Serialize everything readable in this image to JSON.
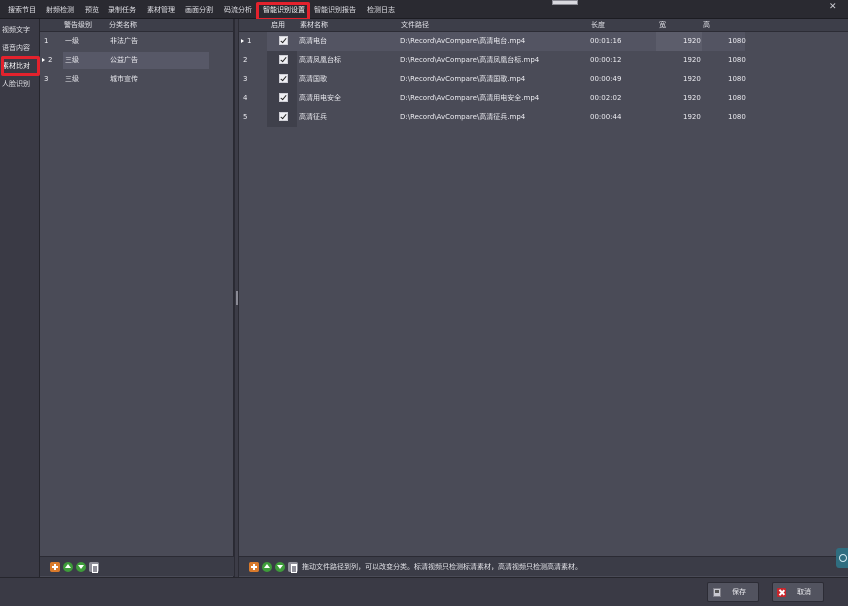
{
  "top_tabs": [
    {
      "label": "搜索节目"
    },
    {
      "label": "射频检测"
    },
    {
      "label": "预览"
    },
    {
      "label": "录制任务"
    },
    {
      "label": "素材管理"
    },
    {
      "label": "画面分割"
    },
    {
      "label": "码流分析"
    },
    {
      "label": "智能识别设置"
    },
    {
      "label": "智能识别报告"
    },
    {
      "label": "检测日志"
    }
  ],
  "left_nav": [
    {
      "label": "视频文字"
    },
    {
      "label": "语音内容"
    },
    {
      "label": "素材比对"
    },
    {
      "label": "人脸识别"
    }
  ],
  "category_table": {
    "headers": {
      "alert_level": "警告级别",
      "category_name": "分类名称"
    },
    "rows": [
      {
        "index": "1",
        "level": "一级",
        "name": "非法广告"
      },
      {
        "index": "2",
        "level": "三级",
        "name": "公益广告"
      },
      {
        "index": "3",
        "level": "三级",
        "name": "城市宣传"
      }
    ]
  },
  "material_table": {
    "headers": {
      "enabled": "启用",
      "name": "素材名称",
      "path": "文件路径",
      "duration": "长度",
      "width": "宽",
      "height": "高"
    },
    "rows": [
      {
        "index": "1",
        "name": "高清电台",
        "path": "D:\\Record\\AvCompare\\高清电台.mp4",
        "duration": "00:01:16",
        "width": "1920",
        "height": "1080"
      },
      {
        "index": "2",
        "name": "高清凤凰台标",
        "path": "D:\\Record\\AvCompare\\高清凤凰台标.mp4",
        "duration": "00:00:12",
        "width": "1920",
        "height": "1080"
      },
      {
        "index": "3",
        "name": "高清国歌",
        "path": "D:\\Record\\AvCompare\\高清国歌.mp4",
        "duration": "00:00:49",
        "width": "1920",
        "height": "1080"
      },
      {
        "index": "4",
        "name": "高清用电安全",
        "path": "D:\\Record\\AvCompare\\高清用电安全.mp4",
        "duration": "00:02:02",
        "width": "1920",
        "height": "1080"
      },
      {
        "index": "5",
        "name": "高清征兵",
        "path": "D:\\Record\\AvCompare\\高清征兵.mp4",
        "duration": "00:00:44",
        "width": "1920",
        "height": "1080"
      }
    ]
  },
  "hint_text": "拖动文件路径到列，可以改变分类。标清视频只检测标清素材，高清视频只检测高清素材。",
  "buttons": {
    "save": "保存",
    "cancel": "取消"
  },
  "colors": {
    "highlight": "#e3222d",
    "background": "#43434f"
  }
}
